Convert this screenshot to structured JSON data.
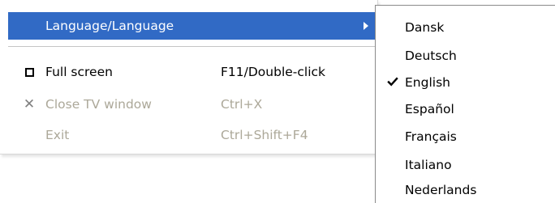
{
  "menu": {
    "items": [
      {
        "label": "Language/Language",
        "shortcut": "",
        "icon": "",
        "state": "highlighted",
        "has_submenu": true
      },
      {
        "label": "Full screen",
        "shortcut": "F11/Double-click",
        "icon": "checkbox-unchecked-icon",
        "state": "enabled",
        "checked": false
      },
      {
        "label": "Close TV window",
        "shortcut": "Ctrl+X",
        "icon": "close-x-icon",
        "state": "disabled"
      },
      {
        "label": "Exit",
        "shortcut": "Ctrl+Shift+F4",
        "icon": "",
        "state": "disabled"
      }
    ]
  },
  "submenu": {
    "items": [
      {
        "label": "Dansk",
        "checked": false
      },
      {
        "label": "Deutsch",
        "checked": false
      },
      {
        "label": "English",
        "checked": true
      },
      {
        "label": "Español",
        "checked": false
      },
      {
        "label": "Français",
        "checked": false
      },
      {
        "label": "Italiano",
        "checked": false
      },
      {
        "label": "Nederlands",
        "checked": false
      }
    ]
  },
  "colors": {
    "highlight": "#316ac5",
    "disabled_text": "#aca899"
  }
}
